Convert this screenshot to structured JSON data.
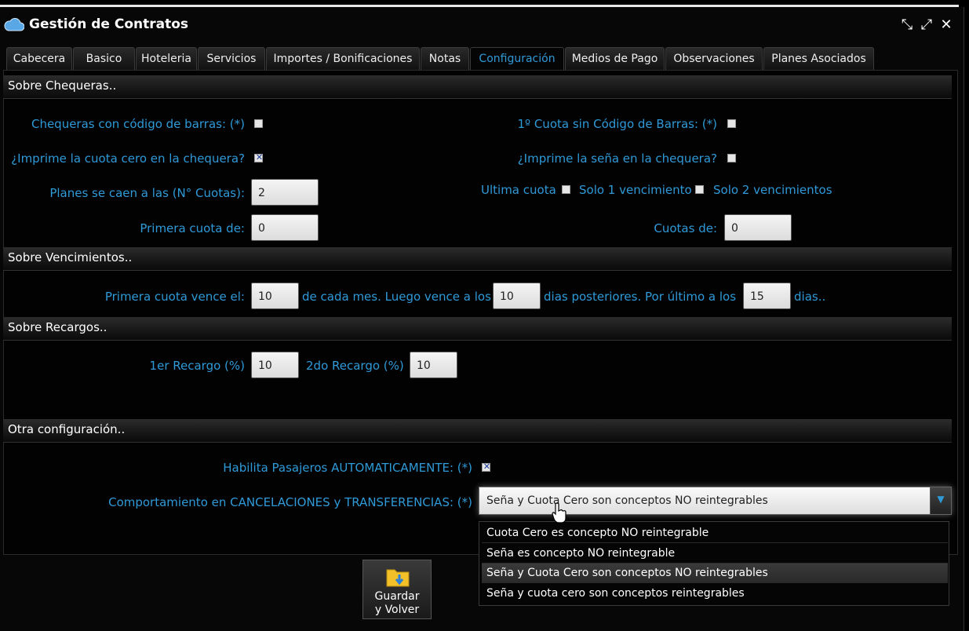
{
  "window": {
    "title": "Gestión de Contratos",
    "controls": {
      "collapse": "⤡",
      "expand": "⤢",
      "close": "✕"
    }
  },
  "tabs": [
    {
      "label": "Cabecera"
    },
    {
      "label": "Basico"
    },
    {
      "label": "Hoteleria"
    },
    {
      "label": "Servicios"
    },
    {
      "label": "Importes / Bonificaciones"
    },
    {
      "label": "Notas"
    },
    {
      "label": "Configuración"
    },
    {
      "label": "Medios de Pago"
    },
    {
      "label": "Observaciones"
    },
    {
      "label": "Planes Asociados"
    }
  ],
  "active_tab": "Configuración",
  "sections": {
    "chequeras": "Sobre Chequeras..",
    "vencimientos": "Sobre Vencimientos..",
    "recargos": "Sobre Recargos..",
    "otra": "Otra configuración.."
  },
  "chequeras": {
    "codigo_barras_label": "Chequeras con código de barras: (*)",
    "codigo_barras_checked": false,
    "primera_sin_codigo_label": "1º Cuota sin Código de Barras: (*)",
    "primera_sin_codigo_checked": false,
    "cuota_cero_label": "¿Imprime la cuota cero en la chequera?",
    "cuota_cero_checked": true,
    "sena_label": "¿Imprime la seña en la chequera?",
    "sena_checked": false,
    "planes_caen_label": "Planes se caen a las (N° Cuotas):",
    "planes_caen_value": "2",
    "ultima_cuota_label": "Ultima cuota",
    "solo1_label": "Solo 1 vencimiento",
    "solo2_label": "Solo 2 vencimientos",
    "primera_cuota_label": "Primera cuota de:",
    "primera_cuota_value": "0",
    "cuotas_de_label": "Cuotas de:",
    "cuotas_de_value": "0"
  },
  "vencimientos": {
    "vence_label": "Primera cuota vence el:",
    "vence_value": "10",
    "cada_mes_text": "de cada mes. Luego vence a los",
    "luego_value": "10",
    "posteriores_text": "dias posteriores. Por último a los",
    "ultimo_value": "15",
    "dias_text": "dias.."
  },
  "recargos": {
    "primer_label": "1er Recargo (%)",
    "primer_value": "10",
    "segundo_label": "2do Recargo (%)",
    "segundo_value": "10"
  },
  "otra": {
    "pasajeros_label": "Habilita Pasajeros AUTOMATICAMENTE: (*)",
    "pasajeros_checked": true,
    "comportamiento_label": "Comportamiento en CANCELACIONES y TRANSFERENCIAS: (*)",
    "comportamiento_value": "Seña y Cuota Cero son conceptos NO reintegrables",
    "options": [
      "Cuota Cero es concepto NO reintegrable",
      "Seña es concepto NO reintegrable",
      "Seña y Cuota Cero son conceptos NO reintegrables",
      "Seña y cuota cero son conceptos reintegrables"
    ],
    "selected_option_index": 2
  },
  "save_button": {
    "label": "Guardar\ny Volver"
  },
  "colors": {
    "accent": "#2f9ad8",
    "background": "#000000",
    "text": "#ffffff"
  }
}
